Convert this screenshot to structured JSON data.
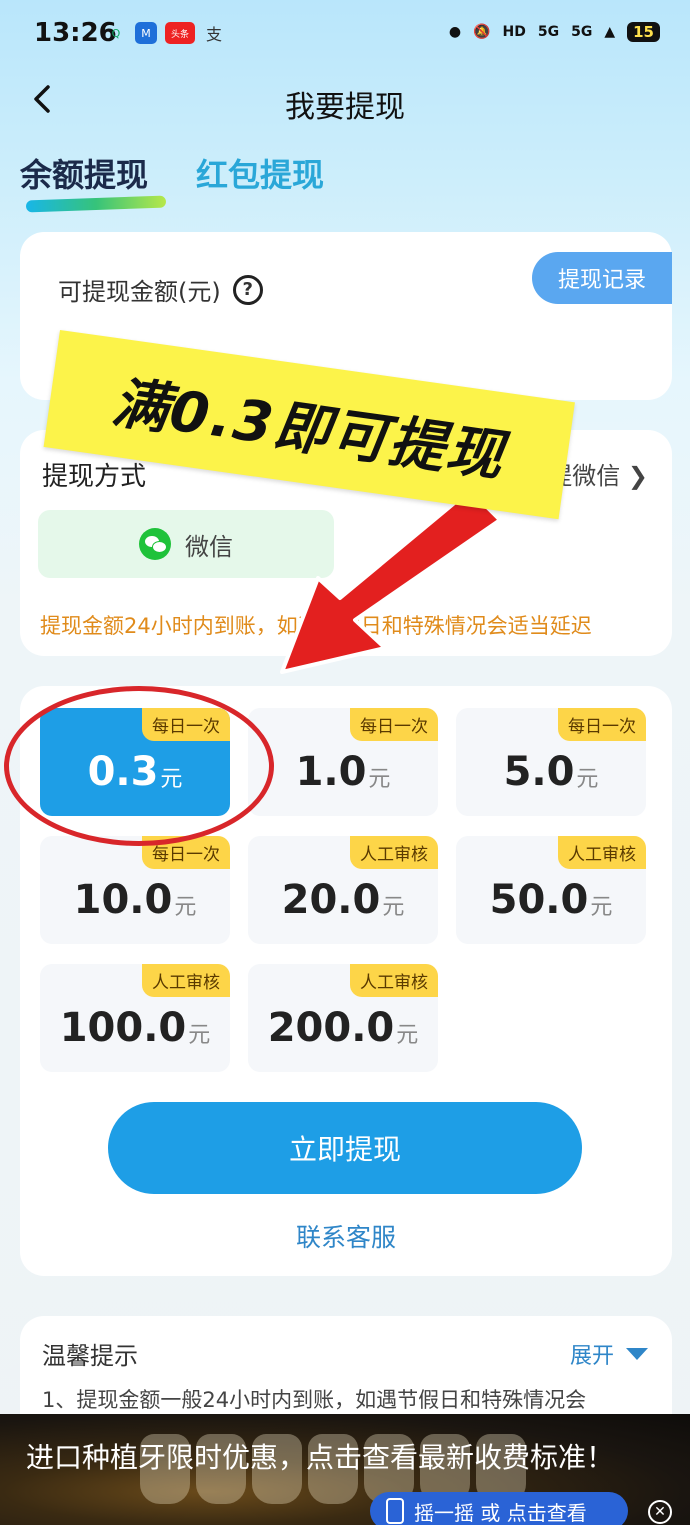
{
  "status_bar": {
    "time": "13:26",
    "apps": [
      "Q",
      "M",
      "头条",
      "支"
    ],
    "network_labels": [
      "HD",
      "5G",
      "5G"
    ],
    "battery": "15"
  },
  "nav": {
    "title": "我要提现"
  },
  "tabs": [
    {
      "label": "余额提现",
      "active": true
    },
    {
      "label": "红包提现",
      "active": false
    }
  ],
  "balance": {
    "label": "可提现金额(元)",
    "record_button": "提现记录"
  },
  "method": {
    "title": "提现方式",
    "switch_label": "提微信",
    "option": "微信",
    "note": "提现金额24小时内到账，如遇节假日和特殊情况会适当延迟"
  },
  "amounts": [
    {
      "value": "0.3",
      "unit": "元",
      "tag": "每日一次",
      "selected": true
    },
    {
      "value": "1.0",
      "unit": "元",
      "tag": "每日一次",
      "selected": false
    },
    {
      "value": "5.0",
      "unit": "元",
      "tag": "每日一次",
      "selected": false
    },
    {
      "value": "10.0",
      "unit": "元",
      "tag": "每日一次",
      "selected": false
    },
    {
      "value": "20.0",
      "unit": "元",
      "tag": "人工审核",
      "selected": false
    },
    {
      "value": "50.0",
      "unit": "元",
      "tag": "人工审核",
      "selected": false
    },
    {
      "value": "100.0",
      "unit": "元",
      "tag": "人工审核",
      "selected": false
    },
    {
      "value": "200.0",
      "unit": "元",
      "tag": "人工审核",
      "selected": false
    }
  ],
  "withdraw_button": "立即提现",
  "service_link": "联系客服",
  "tips": {
    "title": "温馨提示",
    "expand_label": "展开",
    "text": "1、提现金额一般24小时内到账，如遇节假日和特殊情况会"
  },
  "ad": {
    "text": "进口种植牙限时优惠，点击查看最新收费标准！",
    "shake_label": "摇一摇 或 点击查看"
  },
  "promo_overlay": {
    "text": "满0.3即可提现"
  },
  "colors": {
    "accent_blue": "#1e9ee6",
    "tag_yellow": "#fdd548",
    "note_orange": "#e08b1b",
    "promo_yellow": "#fcf34a",
    "arrow_red": "#e3201f"
  }
}
